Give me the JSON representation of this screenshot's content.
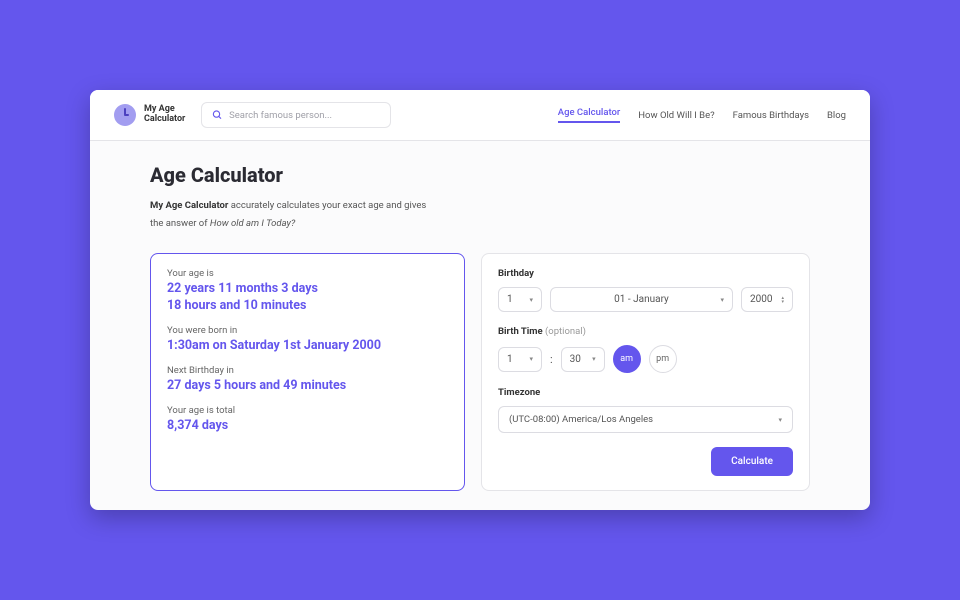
{
  "logo": "My Age\nCalculator",
  "search": {
    "placeholder": "Search famous person..."
  },
  "nav": [
    "Age Calculator",
    "How Old Will I Be?",
    "Famous Birthdays",
    "Blog"
  ],
  "page": {
    "title": "Age Calculator",
    "sub_strong": "My Age Calculator",
    "sub_rest1": " accurately calculates your exact age and gives",
    "sub_rest2": "the answer of ",
    "sub_em": "How old am I Today?"
  },
  "result": {
    "age_label": "Your age is",
    "age_line1": "22 years 11 months 3 days",
    "age_line2": "18 hours and 10 minutes",
    "born_label": "You were born in",
    "born_value": "1:30am on Saturday 1st January 2000",
    "next_label": "Next Birthday in",
    "next_value": "27 days 5 hours and 49 minutes",
    "total_label": "Your age is total",
    "total_value": "8,374 days"
  },
  "form": {
    "birthday_label": "Birthday",
    "birthtime_label": "Birth Time",
    "optional": " (optional)",
    "timezone_label": "Timezone",
    "day": "1",
    "month": "01 - January",
    "year": "2000",
    "hour": "1",
    "minute": "30",
    "am": "am",
    "pm": "pm",
    "timezone": "(UTC-08:00) America/Los Angeles",
    "calculate": "Calculate"
  }
}
